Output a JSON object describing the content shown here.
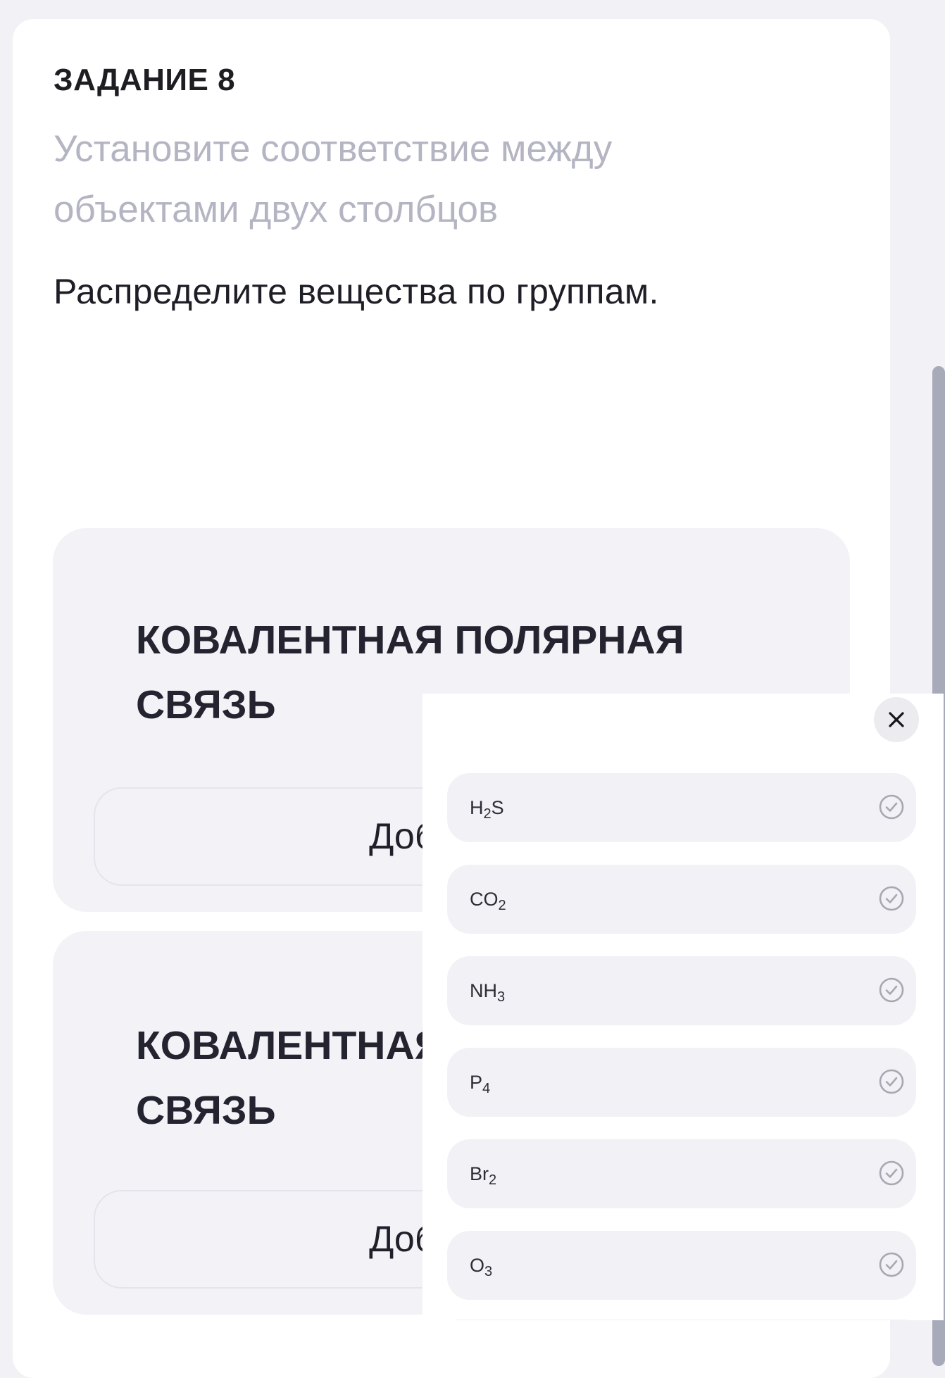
{
  "task": {
    "number": "ЗАДАНИЕ 8",
    "instruction": "Установите соответствие между объектами двух столбцов",
    "prompt": "Распределите вещества по группам."
  },
  "groups": [
    {
      "title": "КОВАЛЕНТНАЯ ПОЛЯРНАЯ СВЯЗЬ",
      "add_label": "Добавить"
    },
    {
      "title": "КОВАЛЕНТНАЯ НЕПОЛЯРНАЯ СВЯЗЬ",
      "add_label": "Добавить"
    }
  ],
  "popup": {
    "close_icon": "close-icon",
    "options": [
      {
        "base": "H",
        "sub": "2",
        "tail": "S"
      },
      {
        "base": "CO",
        "sub": "2",
        "tail": ""
      },
      {
        "base": "NH",
        "sub": "3",
        "tail": ""
      },
      {
        "base": "P",
        "sub": "4",
        "tail": ""
      },
      {
        "base": "Br",
        "sub": "2",
        "tail": ""
      },
      {
        "base": "O",
        "sub": "3",
        "tail": ""
      }
    ],
    "option_icon": "check-circle-icon"
  },
  "colors": {
    "page_background": "#f2f2f6",
    "group_background": "#f2f2f7",
    "muted_text": "#b3b5c2",
    "scrollbar": "#a7aab9"
  }
}
